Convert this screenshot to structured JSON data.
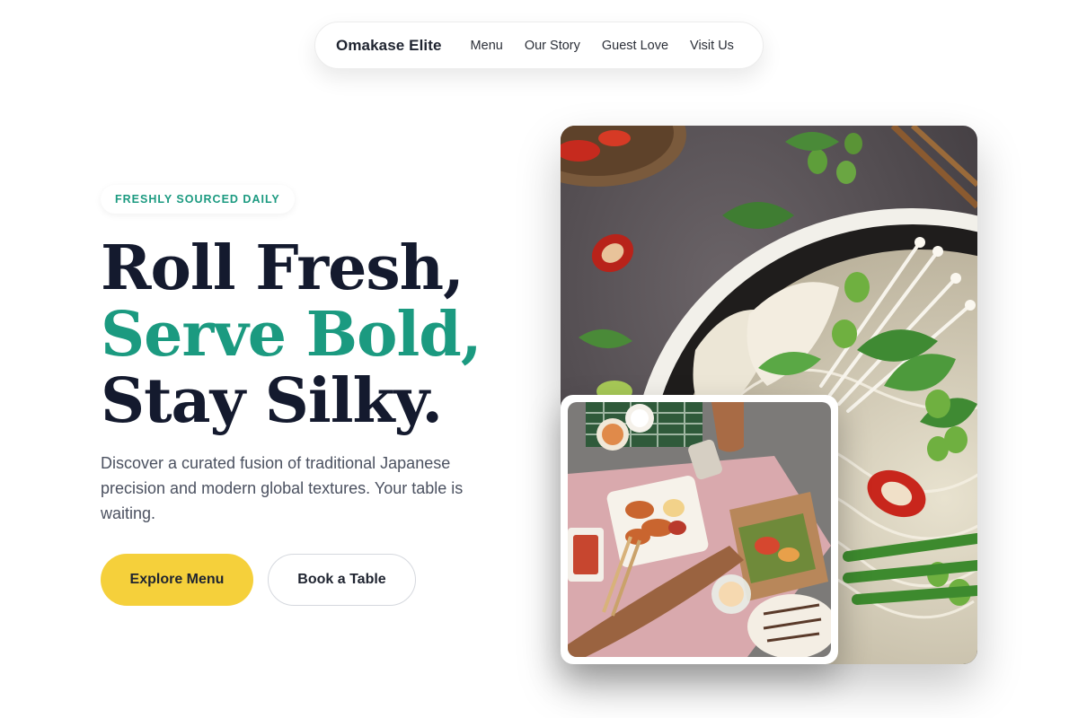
{
  "nav": {
    "brand": "Omakase Elite",
    "links": [
      "Menu",
      "Our Story",
      "Guest Love",
      "Visit Us"
    ]
  },
  "hero": {
    "badge": "FRESHLY SOURCED DAILY",
    "headline": {
      "line1": "Roll Fresh,",
      "line2": "Serve Bold,",
      "line3": "Stay Silky."
    },
    "subtext": "Discover a curated fusion of traditional Japanese precision and modern global textures. Your table is waiting.",
    "primary_cta": "Explore Menu",
    "secondary_cta": "Book a Table"
  },
  "colors": {
    "accent": "#1b9a80",
    "primary_button": "#f5d03b",
    "headline": "#141a2e"
  },
  "images": {
    "main": "noodle-bowl-photo",
    "inset": "shared-table-photo"
  }
}
